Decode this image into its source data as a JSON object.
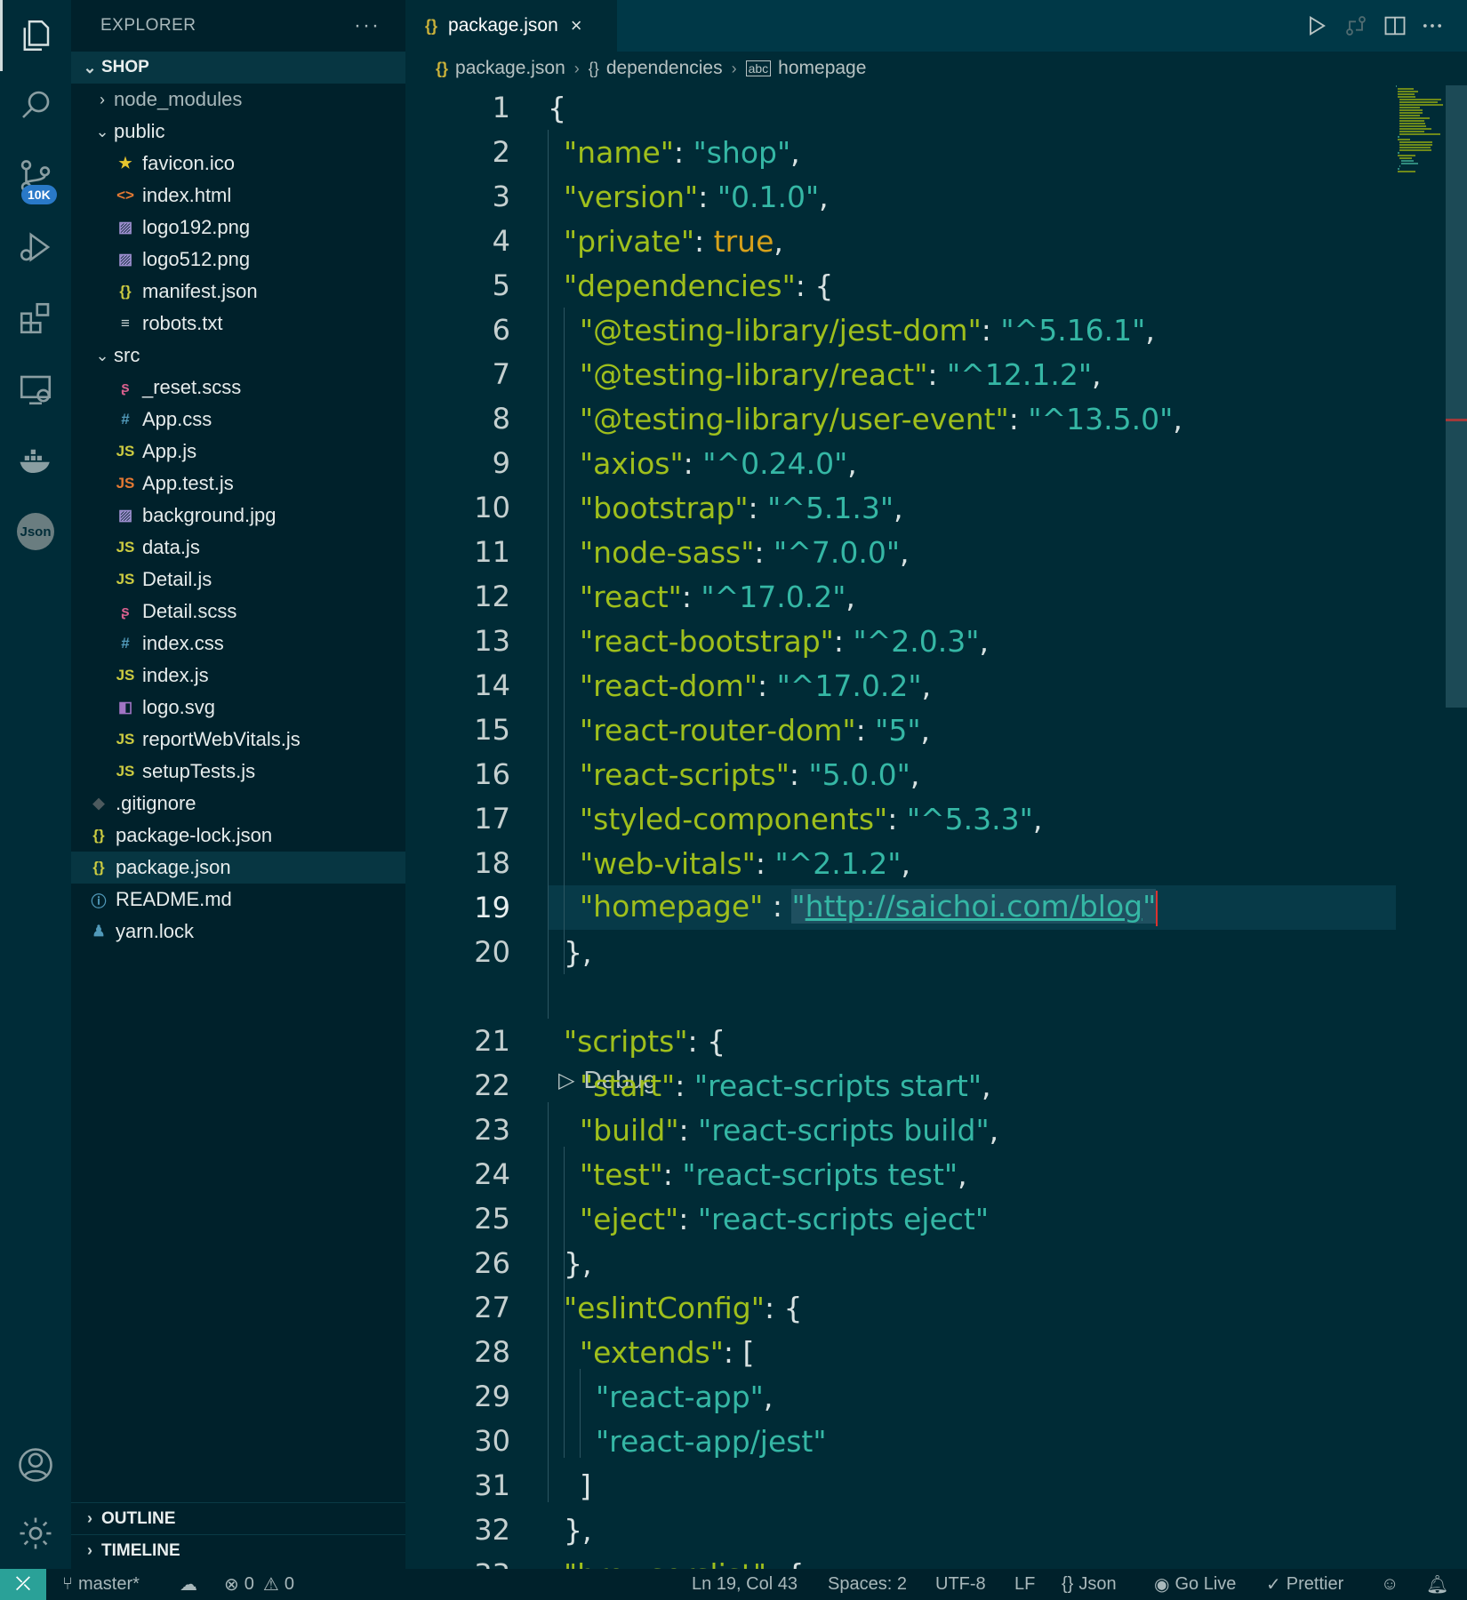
{
  "activity_bar": {
    "items": [
      {
        "name": "explorer-icon"
      },
      {
        "name": "search-icon"
      },
      {
        "name": "source-control-icon",
        "badge": "10K"
      },
      {
        "name": "run-debug-icon"
      },
      {
        "name": "extensions-icon"
      },
      {
        "name": "remote-explorer-icon"
      },
      {
        "name": "docker-icon"
      },
      {
        "name": "json-icon",
        "label": "Json"
      }
    ],
    "bottom": [
      {
        "name": "account-icon"
      },
      {
        "name": "settings-gear-icon"
      }
    ]
  },
  "sidebar": {
    "title": "EXPLORER",
    "more": "···",
    "root": "SHOP",
    "tree": [
      {
        "label": "node_modules",
        "type": "folder",
        "open": false,
        "level": 1,
        "dim": true
      },
      {
        "label": "public",
        "type": "folder",
        "open": true,
        "level": 1
      },
      {
        "label": "favicon.ico",
        "icon": "★",
        "color": "#e6c52e",
        "level": 2
      },
      {
        "label": "index.html",
        "icon": "<>",
        "color": "#e37933",
        "level": 2
      },
      {
        "label": "logo192.png",
        "icon": "▨",
        "color": "#9d8fcf",
        "level": 2
      },
      {
        "label": "logo512.png",
        "icon": "▨",
        "color": "#9d8fcf",
        "level": 2
      },
      {
        "label": "manifest.json",
        "icon": "{}",
        "color": "#cbcb41",
        "level": 2
      },
      {
        "label": "robots.txt",
        "icon": "≡",
        "color": "#c8d2d2",
        "level": 2
      },
      {
        "label": "src",
        "type": "folder",
        "open": true,
        "level": 1
      },
      {
        "label": "_reset.scss",
        "icon": "ʂ",
        "color": "#d8608e",
        "level": 2
      },
      {
        "label": "App.css",
        "icon": "#",
        "color": "#519aba",
        "level": 2
      },
      {
        "label": "App.js",
        "icon": "JS",
        "color": "#cbcb41",
        "level": 2
      },
      {
        "label": "App.test.js",
        "icon": "JS",
        "color": "#e37933",
        "level": 2
      },
      {
        "label": "background.jpg",
        "icon": "▨",
        "color": "#9d8fcf",
        "level": 2
      },
      {
        "label": "data.js",
        "icon": "JS",
        "color": "#cbcb41",
        "level": 2
      },
      {
        "label": "Detail.js",
        "icon": "JS",
        "color": "#cbcb41",
        "level": 2
      },
      {
        "label": "Detail.scss",
        "icon": "ʂ",
        "color": "#d8608e",
        "level": 2
      },
      {
        "label": "index.css",
        "icon": "#",
        "color": "#519aba",
        "level": 2
      },
      {
        "label": "index.js",
        "icon": "JS",
        "color": "#cbcb41",
        "level": 2
      },
      {
        "label": "logo.svg",
        "icon": "◧",
        "color": "#a074c4",
        "level": 2
      },
      {
        "label": "reportWebVitals.js",
        "icon": "JS",
        "color": "#cbcb41",
        "level": 2
      },
      {
        "label": "setupTests.js",
        "icon": "JS",
        "color": "#cbcb41",
        "level": 2
      },
      {
        "label": ".gitignore",
        "icon": "◆",
        "color": "#4d5a5e",
        "level": 1
      },
      {
        "label": "package-lock.json",
        "icon": "{}",
        "color": "#cbcb41",
        "level": 1
      },
      {
        "label": "package.json",
        "icon": "{}",
        "color": "#cbcb41",
        "level": 1,
        "selected": true
      },
      {
        "label": "README.md",
        "icon": "ⓘ",
        "color": "#519aba",
        "level": 1
      },
      {
        "label": "yarn.lock",
        "icon": "♟",
        "color": "#519aba",
        "level": 1
      }
    ],
    "outline": "OUTLINE",
    "timeline": "TIMELINE"
  },
  "editor": {
    "tab": {
      "braces": "{}",
      "label": "package.json",
      "close": "×"
    },
    "breadcrumb": [
      "package.json",
      "dependencies",
      "homepage"
    ],
    "codelens": "Debug",
    "lines": [
      {
        "n": "1",
        "indent": 0,
        "parts": [
          [
            "p",
            "{"
          ]
        ]
      },
      {
        "n": "2",
        "indent": 1,
        "parts": [
          [
            "k",
            "\"name\""
          ],
          [
            "p",
            ": "
          ],
          [
            "s",
            "\"shop\""
          ],
          [
            "p",
            ","
          ]
        ]
      },
      {
        "n": "3",
        "indent": 1,
        "parts": [
          [
            "k",
            "\"version\""
          ],
          [
            "p",
            ": "
          ],
          [
            "s",
            "\"0.1.0\""
          ],
          [
            "p",
            ","
          ]
        ]
      },
      {
        "n": "4",
        "indent": 1,
        "parts": [
          [
            "k",
            "\"private\""
          ],
          [
            "p",
            ": "
          ],
          [
            "b",
            "true"
          ],
          [
            "p",
            ","
          ]
        ]
      },
      {
        "n": "5",
        "indent": 1,
        "parts": [
          [
            "k",
            "\"dependencies\""
          ],
          [
            "p",
            ": {"
          ]
        ]
      },
      {
        "n": "6",
        "indent": 2,
        "parts": [
          [
            "k",
            "\"@testing-library/jest-dom\""
          ],
          [
            "p",
            ": "
          ],
          [
            "s",
            "\"^5.16.1\""
          ],
          [
            "p",
            ","
          ]
        ]
      },
      {
        "n": "7",
        "indent": 2,
        "parts": [
          [
            "k",
            "\"@testing-library/react\""
          ],
          [
            "p",
            ": "
          ],
          [
            "s",
            "\"^12.1.2\""
          ],
          [
            "p",
            ","
          ]
        ]
      },
      {
        "n": "8",
        "indent": 2,
        "parts": [
          [
            "k",
            "\"@testing-library/user-event\""
          ],
          [
            "p",
            ": "
          ],
          [
            "s",
            "\"^13.5.0\""
          ],
          [
            "p",
            ","
          ]
        ]
      },
      {
        "n": "9",
        "indent": 2,
        "parts": [
          [
            "k",
            "\"axios\""
          ],
          [
            "p",
            ": "
          ],
          [
            "s",
            "\"^0.24.0\""
          ],
          [
            "p",
            ","
          ]
        ]
      },
      {
        "n": "10",
        "indent": 2,
        "parts": [
          [
            "k",
            "\"bootstrap\""
          ],
          [
            "p",
            ": "
          ],
          [
            "s",
            "\"^5.1.3\""
          ],
          [
            "p",
            ","
          ]
        ]
      },
      {
        "n": "11",
        "indent": 2,
        "parts": [
          [
            "k",
            "\"node-sass\""
          ],
          [
            "p",
            ": "
          ],
          [
            "s",
            "\"^7.0.0\""
          ],
          [
            "p",
            ","
          ]
        ]
      },
      {
        "n": "12",
        "indent": 2,
        "parts": [
          [
            "k",
            "\"react\""
          ],
          [
            "p",
            ": "
          ],
          [
            "s",
            "\"^17.0.2\""
          ],
          [
            "p",
            ","
          ]
        ]
      },
      {
        "n": "13",
        "indent": 2,
        "parts": [
          [
            "k",
            "\"react-bootstrap\""
          ],
          [
            "p",
            ": "
          ],
          [
            "s",
            "\"^2.0.3\""
          ],
          [
            "p",
            ","
          ]
        ]
      },
      {
        "n": "14",
        "indent": 2,
        "parts": [
          [
            "k",
            "\"react-dom\""
          ],
          [
            "p",
            ": "
          ],
          [
            "s",
            "\"^17.0.2\""
          ],
          [
            "p",
            ","
          ]
        ]
      },
      {
        "n": "15",
        "indent": 2,
        "parts": [
          [
            "k",
            "\"react-router-dom\""
          ],
          [
            "p",
            ": "
          ],
          [
            "s",
            "\"5\""
          ],
          [
            "p",
            ","
          ]
        ]
      },
      {
        "n": "16",
        "indent": 2,
        "parts": [
          [
            "k",
            "\"react-scripts\""
          ],
          [
            "p",
            ": "
          ],
          [
            "s",
            "\"5.0.0\""
          ],
          [
            "p",
            ","
          ]
        ]
      },
      {
        "n": "17",
        "indent": 2,
        "parts": [
          [
            "k",
            "\"styled-components\""
          ],
          [
            "p",
            ": "
          ],
          [
            "s",
            "\"^5.3.3\""
          ],
          [
            "p",
            ","
          ]
        ]
      },
      {
        "n": "18",
        "indent": 2,
        "parts": [
          [
            "k",
            "\"web-vitals\""
          ],
          [
            "p",
            ": "
          ],
          [
            "s",
            "\"^2.1.2\""
          ],
          [
            "p",
            ","
          ]
        ]
      },
      {
        "n": "19",
        "indent": 2,
        "current": true,
        "parts": [
          [
            "k",
            "\"homepage\""
          ],
          [
            "p",
            " : "
          ],
          [
            "sel",
            "\""
          ],
          [
            "link",
            "http://saichoi.com/blog"
          ],
          [
            "sel",
            "\""
          ],
          [
            "cursor",
            ""
          ]
        ]
      },
      {
        "n": "20",
        "indent": 1,
        "parts": [
          [
            "p",
            "},"
          ]
        ]
      },
      {
        "n": "21",
        "indent": 1,
        "parts": [
          [
            "k",
            "\"scripts\""
          ],
          [
            "p",
            ": {"
          ]
        ]
      },
      {
        "n": "22",
        "indent": 2,
        "parts": [
          [
            "k",
            "\"start\""
          ],
          [
            "p",
            ": "
          ],
          [
            "s",
            "\"react-scripts start\""
          ],
          [
            "p",
            ","
          ]
        ]
      },
      {
        "n": "23",
        "indent": 2,
        "parts": [
          [
            "k",
            "\"build\""
          ],
          [
            "p",
            ": "
          ],
          [
            "s",
            "\"react-scripts build\""
          ],
          [
            "p",
            ","
          ]
        ]
      },
      {
        "n": "24",
        "indent": 2,
        "parts": [
          [
            "k",
            "\"test\""
          ],
          [
            "p",
            ": "
          ],
          [
            "s",
            "\"react-scripts test\""
          ],
          [
            "p",
            ","
          ]
        ]
      },
      {
        "n": "25",
        "indent": 2,
        "parts": [
          [
            "k",
            "\"eject\""
          ],
          [
            "p",
            ": "
          ],
          [
            "s",
            "\"react-scripts eject\""
          ]
        ]
      },
      {
        "n": "26",
        "indent": 1,
        "parts": [
          [
            "p",
            "},"
          ]
        ]
      },
      {
        "n": "27",
        "indent": 1,
        "parts": [
          [
            "k",
            "\"eslintConfig\""
          ],
          [
            "p",
            ": {"
          ]
        ]
      },
      {
        "n": "28",
        "indent": 2,
        "parts": [
          [
            "k",
            "\"extends\""
          ],
          [
            "p",
            ": ["
          ]
        ]
      },
      {
        "n": "29",
        "indent": 3,
        "parts": [
          [
            "s",
            "\"react-app\""
          ],
          [
            "p",
            ","
          ]
        ]
      },
      {
        "n": "30",
        "indent": 3,
        "parts": [
          [
            "s",
            "\"react-app/jest\""
          ]
        ]
      },
      {
        "n": "31",
        "indent": 2,
        "parts": [
          [
            "p",
            "]"
          ]
        ]
      },
      {
        "n": "32",
        "indent": 1,
        "parts": [
          [
            "p",
            "},"
          ]
        ]
      },
      {
        "n": "33",
        "indent": 1,
        "parts": [
          [
            "k",
            "\"browserslist\""
          ],
          [
            "p",
            ": {"
          ]
        ]
      }
    ]
  },
  "statusbar": {
    "branch": "master*",
    "errors": "0",
    "warnings": "0",
    "position": "Ln 19, Col 43",
    "spaces": "Spaces: 2",
    "encoding": "UTF-8",
    "eol": "LF",
    "language": "Json",
    "golive": "Go Live",
    "prettier": "Prettier"
  },
  "colors": {
    "keys": "#9fbf1c",
    "strings": "#35b7a5",
    "boolean": "#d7a11b",
    "accent": "#2aa198"
  }
}
